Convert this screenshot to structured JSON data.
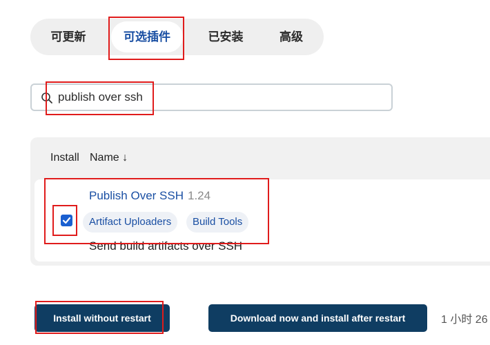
{
  "tabs": [
    {
      "label": "可更新"
    },
    {
      "label": "可选插件"
    },
    {
      "label": "已安装"
    },
    {
      "label": "高级"
    }
  ],
  "search": {
    "value": "publish over ssh",
    "icon": "search-icon"
  },
  "table": {
    "headers": {
      "install": "Install",
      "name": "Name ↓"
    },
    "rows": [
      {
        "checked": true,
        "name": "Publish Over SSH",
        "version": "1.24",
        "tags": [
          "Artifact Uploaders",
          "Build Tools"
        ],
        "description": "Send build artifacts over SSH"
      }
    ]
  },
  "buttons": {
    "install_without_restart": "Install without restart",
    "download_and_install": "Download now and install after restart"
  },
  "update_info": "1 小时 26",
  "colors": {
    "accent": "#1a4fa3",
    "button_bg": "#0f3d62",
    "highlight": "#e01b1b",
    "checkbox": "#1a5fd0"
  }
}
